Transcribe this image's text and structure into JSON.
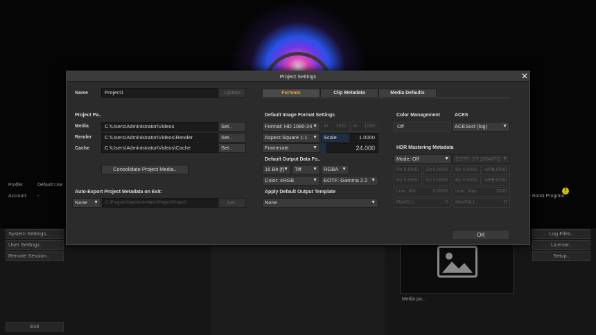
{
  "background": {
    "profile_label": "Profile:",
    "profile_value": "Default Use",
    "account_label": "Account:",
    "account_value": "-",
    "system_settings": "System Settings..",
    "user_settings": "User Settings..",
    "remote_session": "Remote Session..",
    "exit": "Exit",
    "log_files": "Log Files..",
    "license": "License..",
    "setup": "Setup..",
    "boost_text": "e Boost Program",
    "warning": "!",
    "media_caption": "Media pa..."
  },
  "dialog": {
    "title": "Project Settings",
    "close": "✕",
    "name_label": "Name",
    "name_value": "Project1",
    "update_button": "Update",
    "project_paths_header": "Project Pa..",
    "media_label": "Media",
    "media_value": "C:\\Users\\Administrator\\Videos",
    "render_label": "Render",
    "render_value": "C:\\Users\\Administrator\\Videos\\Render",
    "cache_label": "Cache",
    "cache_value": "C:\\Users\\Administrator\\Videos\\Cache",
    "set_button": "Set..",
    "consolidate_button": "Consolidate Project Media..",
    "auto_export_header": "Auto-Export Project Metadata on Exit:",
    "auto_export_mode": "None",
    "auto_export_path": "C:\\ProgramData\\Assimilator\\Project\\Project1",
    "ok_button": "OK"
  },
  "tabs": [
    {
      "label": "Formats",
      "active": true
    },
    {
      "label": "Clip Metadata",
      "active": false
    },
    {
      "label": "Media Defaults",
      "active": false
    }
  ],
  "image_format": {
    "header": "Default Image Format Settings",
    "format": "Format: HD 1080-24",
    "w_label": "W",
    "w_value": "1920",
    "h_label": "H",
    "h_value": "1080",
    "aspect": "Aspect Square 1:1",
    "scale_label": "Scale",
    "scale_value": "1.0000",
    "framerate": "Framerate",
    "framerate_value": "24.000"
  },
  "output_data": {
    "header": "Default Output Data Fo..",
    "bit_depth": "16 Bit (f)",
    "file_type": "Tiff",
    "channels": "RGBA",
    "color": "Color: sRGB",
    "eotf": "EOTF: Gamma 2.2",
    "template_header": "Apply Default Output Template",
    "template_value": "None"
  },
  "color_management": {
    "header": "Color Management",
    "value": "Off"
  },
  "aces": {
    "header": "ACES",
    "value": "ACEScct (log)"
  },
  "hdr": {
    "header": "HDR Mastering Metadata",
    "mode": "Mode: Off",
    "eotf": "EOTF: ST 2084/PQ",
    "rx_label": "Rx",
    "rx_value": "0.0000",
    "gx_label": "Gx",
    "gx_value": "0.0000",
    "bx_label": "Bx",
    "bx_value": "0.0000",
    "wpx_label": "WPx",
    "wpx_value": "0.0000",
    "ry_label": "Ry",
    "ry_value": "0.0000",
    "gy_label": "Gy",
    "gy_value": "0.0000",
    "by_label": "By",
    "by_value": "0.0000",
    "wpy_label": "WPy",
    "wpy_value": "0.0000",
    "lum_min_label": "Lum. Min",
    "lum_min_value": "0.0000",
    "lum_max_label": "Lum. Max",
    "lum_max_value": "1000",
    "maxcll_label": "MaxCLL",
    "maxcll_value": "0",
    "maxfall_label": "MaxFALL",
    "maxfall_value": "0"
  },
  "colors": {
    "accent": "#e8a33a",
    "dialog_bg": "#2b2b2b",
    "field_bg": "#1b1b1b",
    "warning": "#d8c200"
  }
}
